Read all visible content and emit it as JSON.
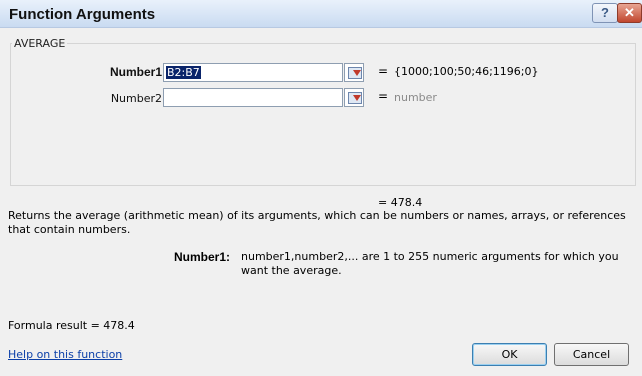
{
  "window": {
    "title": "Function Arguments",
    "help_glyph": "?",
    "close_glyph": "✕"
  },
  "function_name": "AVERAGE",
  "arguments": [
    {
      "label": "Number1",
      "value": "B2:B7",
      "result": "{1000;100;50;46;1196;0}"
    },
    {
      "label": "Number2",
      "value": "",
      "result": "number"
    }
  ],
  "equals_sign": "=",
  "overall_result": "=  478.4",
  "description": "Returns the average (arithmetic mean) of its arguments, which can be numbers or names, arrays, or references that contain numbers.",
  "argument_help": {
    "name": "Number1:",
    "text": "number1,number2,... are 1 to 255 numeric arguments for which you want the average."
  },
  "formula_result": "Formula result =  478.4",
  "help_link": "Help on this function",
  "buttons": {
    "ok": "OK",
    "cancel": "Cancel"
  },
  "colors": {
    "titlebar": "#c9dbf1",
    "link": "#0b3fa8",
    "selection": "#0a246a"
  }
}
